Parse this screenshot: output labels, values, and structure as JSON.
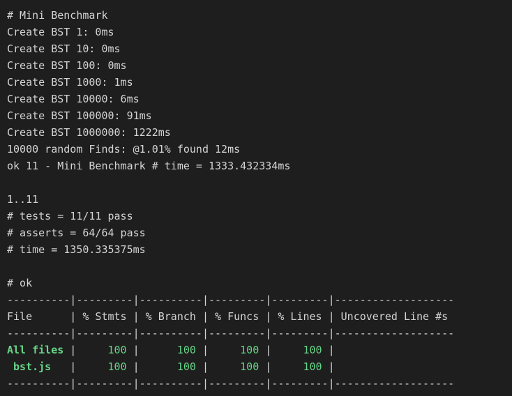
{
  "terminal": {
    "theme": {
      "background": "#1e1e1e",
      "text": "#d4d4d4",
      "success": "#67d588"
    },
    "lines": [
      "# Mini Benchmark",
      "Create BST 1: 0ms",
      "Create BST 10: 0ms",
      "Create BST 100: 0ms",
      "Create BST 1000: 1ms",
      "Create BST 10000: 6ms",
      "Create BST 100000: 91ms",
      "Create BST 1000000: 1222ms",
      "10000 random Finds: @1.01% found 12ms",
      "ok 11 - Mini Benchmark # time = 1333.432334ms",
      "",
      "1..11",
      "# tests = 11/11 pass",
      "# asserts = 64/64 pass",
      "# time = 1350.335375ms",
      "",
      "# ok"
    ],
    "coverage": {
      "separator": "----------|---------|----------|---------|---------|-------------------",
      "header": "File      | % Stmts | % Branch | % Funcs | % Lines | Uncovered Line #s",
      "rows": [
        {
          "file": "All files",
          "stmts": "100",
          "branch": "100",
          "funcs": "100",
          "lines": "100",
          "uncovered": ""
        },
        {
          "file": " bst.js",
          "stmts": "100",
          "branch": "100",
          "funcs": "100",
          "lines": "100",
          "uncovered": ""
        }
      ]
    }
  }
}
